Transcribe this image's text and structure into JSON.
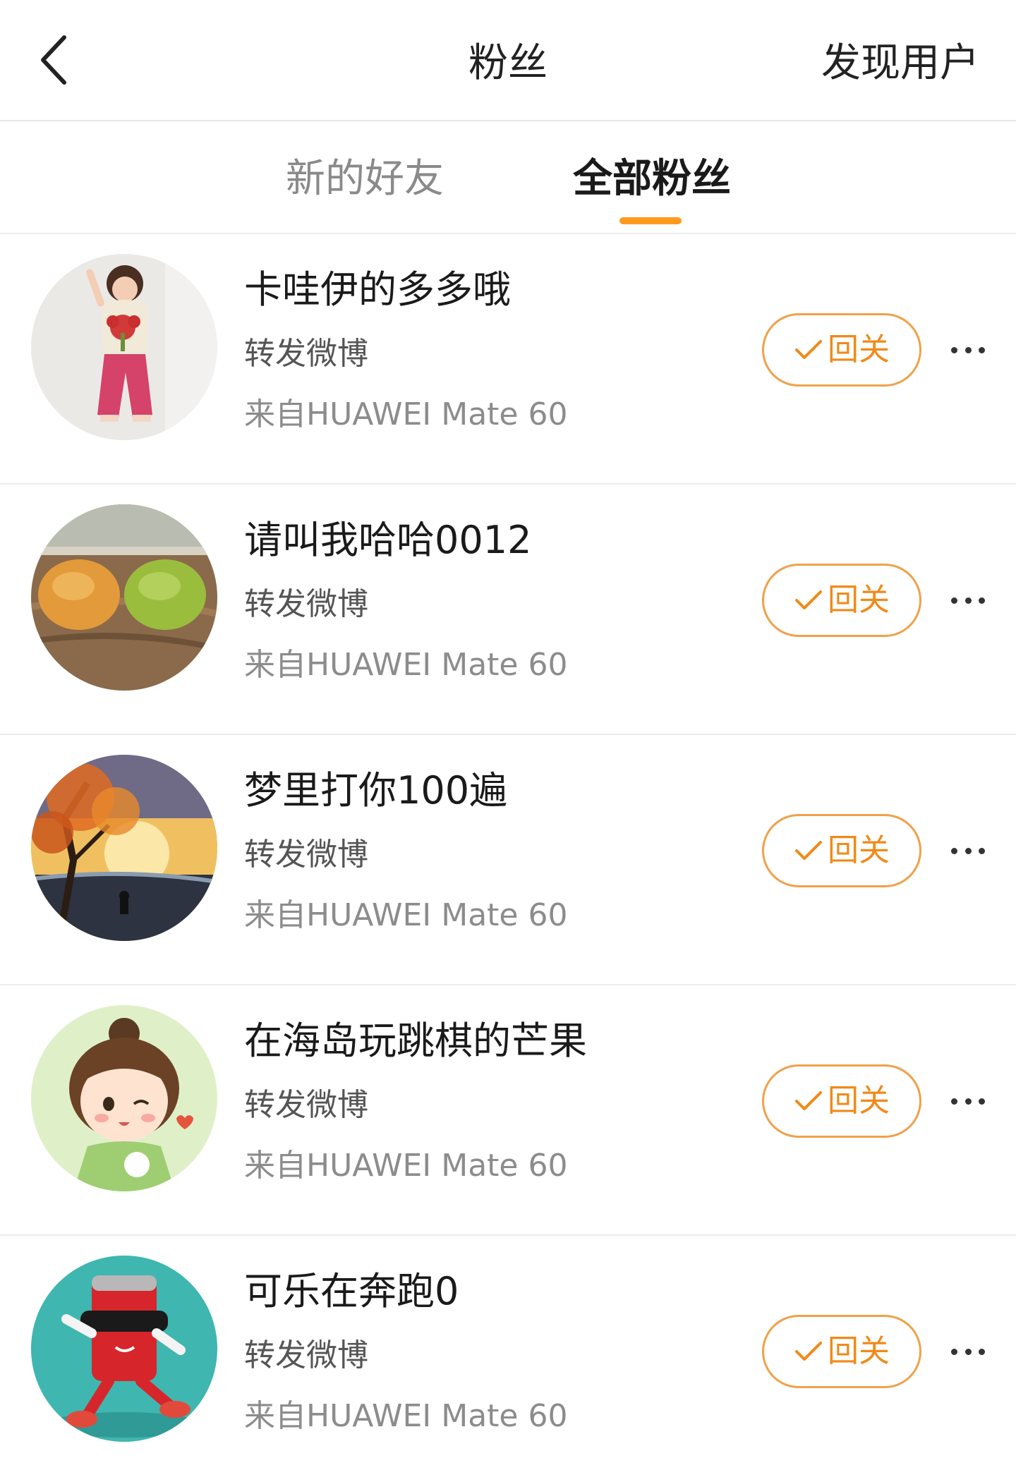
{
  "header": {
    "title": "粉丝",
    "right_action": "发现用户"
  },
  "tabs": [
    {
      "label": "新的好友",
      "active": false
    },
    {
      "label": "全部粉丝",
      "active": true
    }
  ],
  "accent_color": "#ff9a1e",
  "fans": [
    {
      "name": "卡哇伊的多多哦",
      "reason": "转发微博",
      "source": "来自HUAWEI Mate 60",
      "button": "回关",
      "avatar": "girl-photo"
    },
    {
      "name": "请叫我哈哈0012",
      "reason": "转发微博",
      "source": "来自HUAWEI Mate 60",
      "button": "回关",
      "avatar": "buns-photo"
    },
    {
      "name": "梦里打你100遍",
      "reason": "转发微博",
      "source": "来自HUAWEI Mate 60",
      "button": "回关",
      "avatar": "autumn-tree-painting"
    },
    {
      "name": "在海岛玩跳棋的芒果",
      "reason": "转发微博",
      "source": "来自HUAWEI Mate 60",
      "button": "回关",
      "avatar": "cartoon-girl"
    },
    {
      "name": "可乐在奔跑0",
      "reason": "转发微博",
      "source": "来自HUAWEI Mate 60",
      "button": "回关",
      "avatar": "running-can-cartoon"
    }
  ]
}
